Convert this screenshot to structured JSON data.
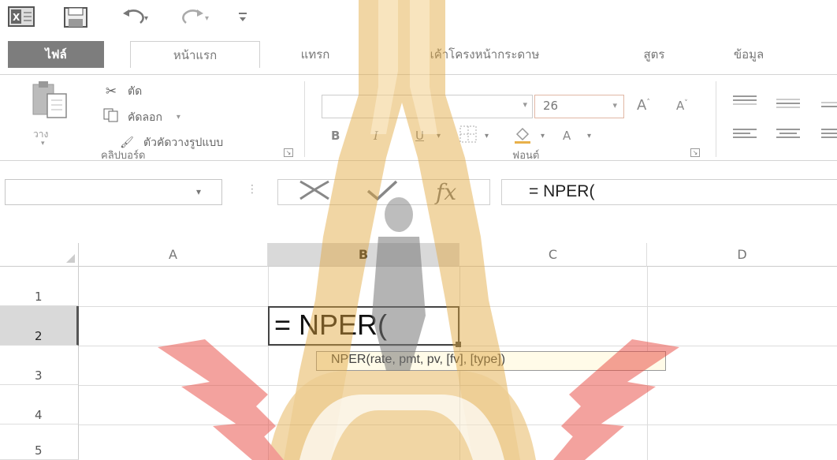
{
  "quick_access": {
    "icons": [
      "excel-icon",
      "save-icon",
      "undo-icon",
      "redo-icon",
      "customize-icon"
    ]
  },
  "tabs": [
    {
      "label": "ไฟล์"
    },
    {
      "label": "หน้าแรก"
    },
    {
      "label": "แทรก"
    },
    {
      "label": "เค้าโครงหน้ากระดาษ"
    },
    {
      "label": "สูตร"
    },
    {
      "label": "ข้อมูล"
    }
  ],
  "clipboard": {
    "paste_label": "วาง",
    "cut_label": "ตัด",
    "copy_label": "คัดลอก",
    "format_painter_label": "ตัวคัดวางรูปแบบ",
    "group_label": "คลิปบอร์ด"
  },
  "font": {
    "font_name": "",
    "font_size": "26",
    "bold": "B",
    "italic": "I",
    "underline": "U",
    "grow": "A",
    "shrink": "A",
    "color": "A",
    "group_label": "ฟอนต์"
  },
  "formula_bar": {
    "name_box": "",
    "content": "= NPER("
  },
  "grid": {
    "columns": [
      "A",
      "B",
      "C",
      "D"
    ],
    "rows": [
      "1",
      "2",
      "3",
      "4",
      "5"
    ],
    "active_cell_value": "= NPER(",
    "tooltip": "NPER(rate, pmt, pv, [fv], [type])"
  },
  "colors": {
    "watermark_gold": "#e0a63c",
    "watermark_red": "#e8453c",
    "file_tab": "#7d7d7d",
    "selected_header": "#d9d9d9"
  }
}
